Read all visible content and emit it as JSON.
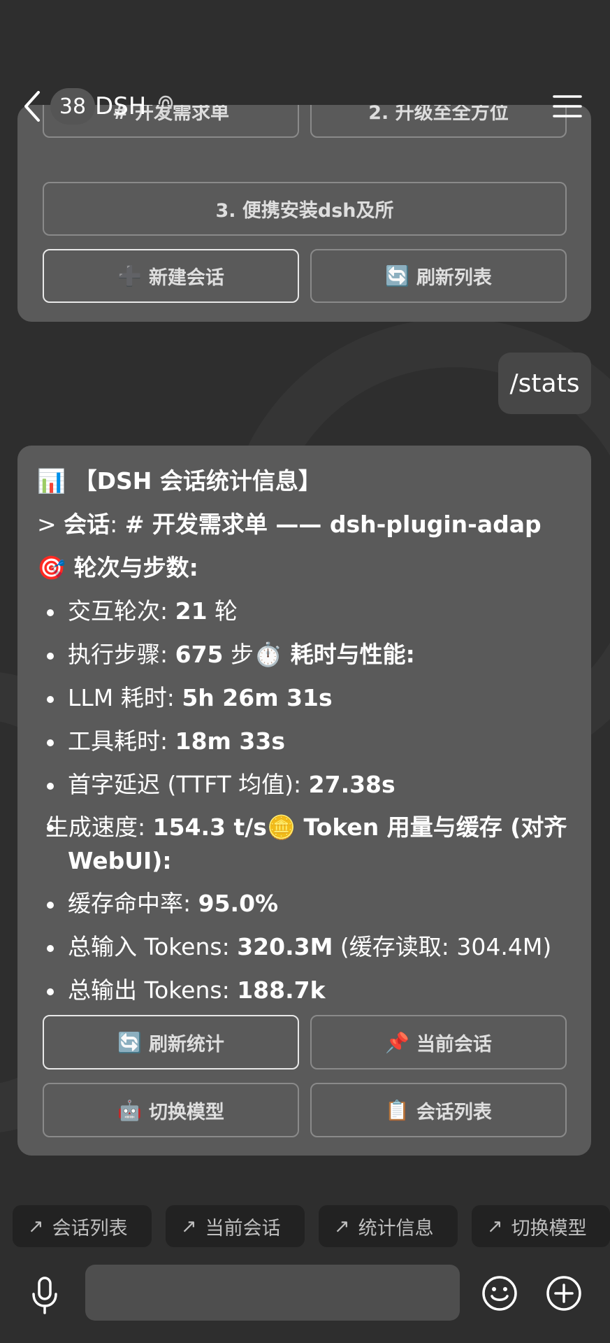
{
  "header": {
    "badge": "38",
    "title": "DSH"
  },
  "top_card": {
    "partial_buttons": [
      "# 开发需求单",
      "2. 升级至全方位"
    ],
    "wide_button": "3. 便携安装dsh及所",
    "new_session": {
      "emoji": "➕",
      "label": "新建会话"
    },
    "refresh_list": {
      "emoji": "🔄",
      "label": "刷新列表"
    }
  },
  "user_message": "/stats",
  "stats": {
    "title_emoji": "📊",
    "title": "【DSH 会话统计信息】",
    "session_prefix": "> ",
    "session_label": "会话",
    "session_value": "# 开发需求单 —— dsh-plugin-adap",
    "rounds_emoji": "🎯",
    "rounds_heading": "轮次与步数:",
    "turns_label": "交互轮次: ",
    "turns_value": "21",
    "turns_unit": " 轮",
    "steps_label": "执行步骤: ",
    "steps_value": "675",
    "steps_unit": " 步",
    "timing_emoji": "⏱️",
    "timing_heading": " 耗时与性能:",
    "llm_label": "LLM 耗时: ",
    "llm_value": "5h 26m 31s",
    "tool_label": "工具耗时: ",
    "tool_value": "18m 33s",
    "ttft_label": "首字延迟 (TTFT 均值): ",
    "ttft_value": "27.38s",
    "speed_label": "生成速度: ",
    "speed_value": "154.3 t/s",
    "token_emoji": "🪙",
    "token_heading": " Token 用量与缓存 (对齐 WebUI):",
    "cache_label": "缓存命中率: ",
    "cache_value": "95.0%",
    "input_label": "总输入 Tokens: ",
    "input_value": "320.3M",
    "input_extra": " (缓存读取: 304.4M)",
    "output_label": "总输出 Tokens: ",
    "output_value": "188.7k"
  },
  "stats_buttons": [
    {
      "emoji": "🔄",
      "label": "刷新统计"
    },
    {
      "emoji": "📌",
      "label": "当前会话"
    },
    {
      "emoji": "🤖",
      "label": "切换模型"
    },
    {
      "emoji": "📋",
      "label": "会话列表"
    }
  ],
  "quick_actions": [
    {
      "icon": "↗",
      "label": "会话列表"
    },
    {
      "icon": "↗",
      "label": "当前会话"
    },
    {
      "icon": "↗",
      "label": "统计信息"
    },
    {
      "icon": "↗",
      "label": "切换模型"
    }
  ],
  "input": {
    "value": "",
    "placeholder": ""
  },
  "colors": {
    "background": "#2e2e2e",
    "card": "#5a5a5a",
    "bubble": "#474747",
    "chip": "#222222",
    "input": "#4e4e4e"
  }
}
